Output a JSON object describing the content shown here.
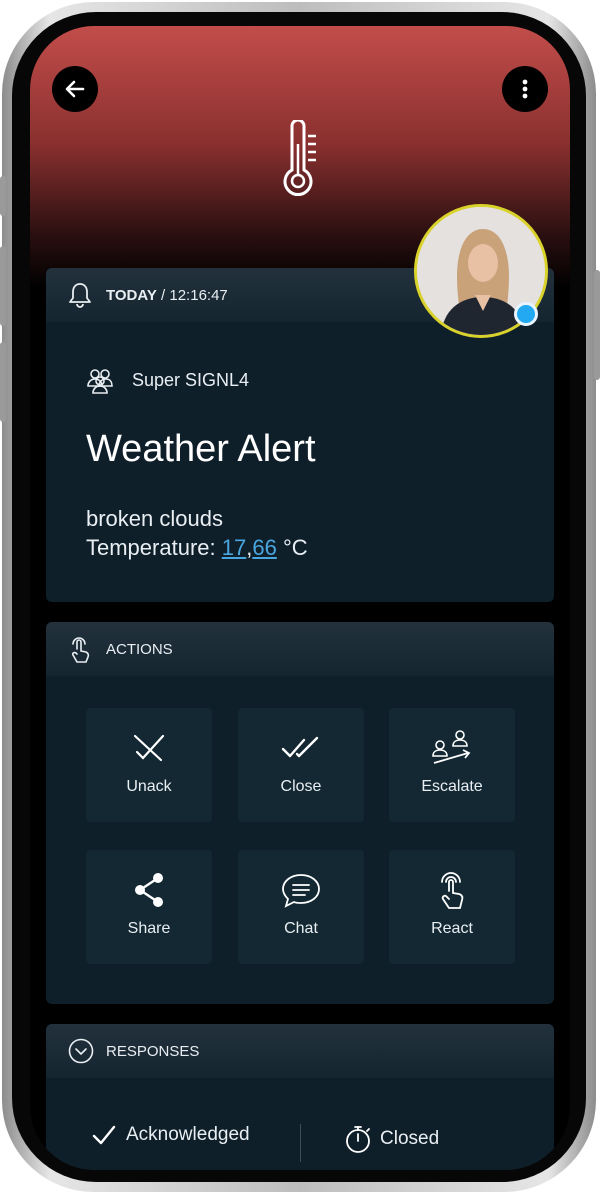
{
  "header": {
    "back_icon": "arrow-left-icon",
    "menu_icon": "more-vertical-icon",
    "category_icon": "thermometer-icon",
    "accent_color": "#c24d4a"
  },
  "alert": {
    "time_label": "TODAY",
    "time_sep": " / ",
    "time_value": "12:16:47",
    "group": "Super SIGNL4",
    "title": "Weather Alert",
    "line1": "broken clouds",
    "temp_prefix": "Temperature: ",
    "temp_int": "17",
    "temp_comma": ",",
    "temp_dec": "66",
    "temp_unit": " °C",
    "link_color": "#4aa6e0"
  },
  "actions": {
    "heading": "ACTIONS",
    "items": [
      {
        "label": "Unack",
        "icon": "unack-icon"
      },
      {
        "label": "Close",
        "icon": "double-check-icon"
      },
      {
        "label": "Escalate",
        "icon": "escalate-icon"
      },
      {
        "label": "Share",
        "icon": "share-icon"
      },
      {
        "label": "Chat",
        "icon": "chat-icon"
      },
      {
        "label": "React",
        "icon": "touch-icon"
      }
    ]
  },
  "responses": {
    "heading": "RESPONSES",
    "acknowledged": "Acknowledged",
    "closed": "Closed"
  },
  "status": {
    "online_color": "#23a9f2",
    "avatar_ring_color": "#d9d22a"
  }
}
